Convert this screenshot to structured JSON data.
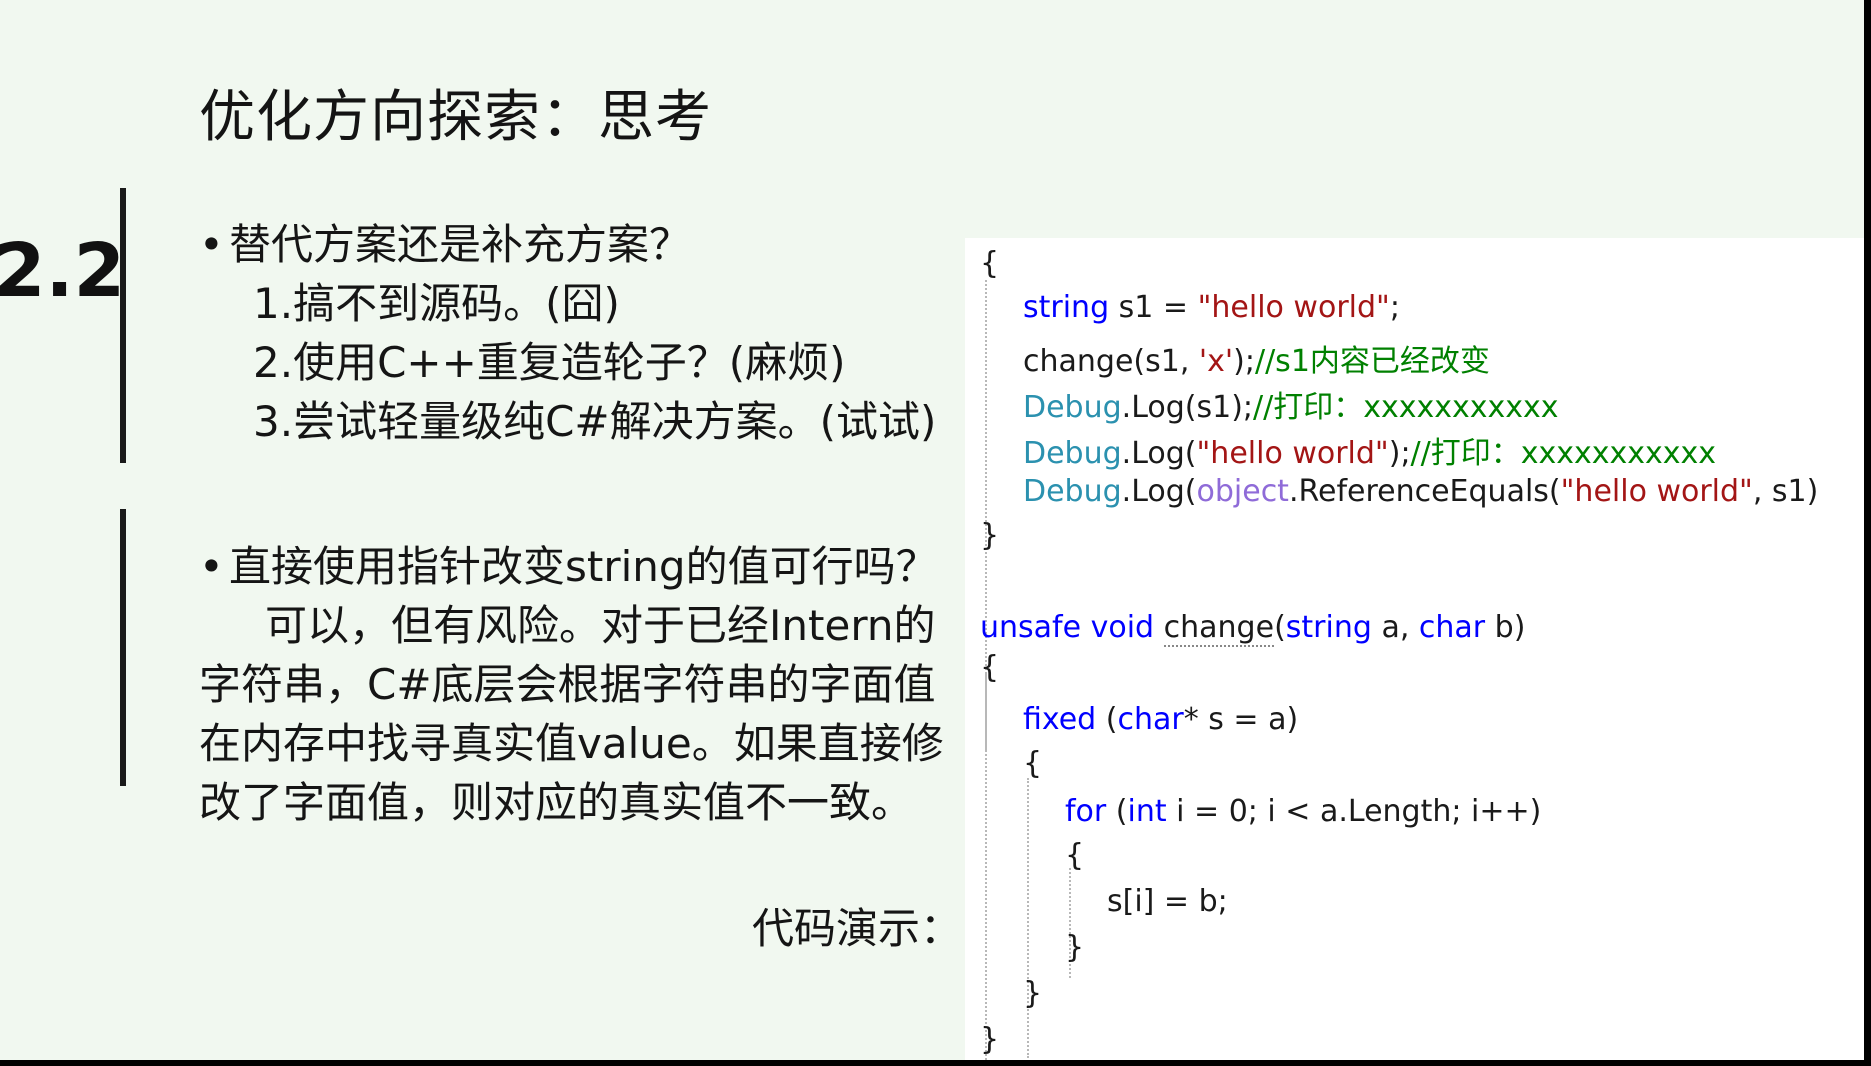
{
  "slide": {
    "title": "优化方向探索：思考",
    "section_number": "2.2",
    "bullet1": {
      "dot": "•",
      "heading": "替代方案还是补充方案？",
      "items": [
        "1.搞不到源码。(囧)",
        "2.使用C++重复造轮子？(麻烦)",
        "3.尝试轻量级纯C#解决方案。(试试)"
      ]
    },
    "bullet2": {
      "dot": "•",
      "heading": "直接使用指针改变string的值可行吗？",
      "lines": [
        "可以，但有风险。对于已经Intern的",
        "字符串，C#底层会根据字符串的字面值",
        "在内存中找寻真实值value。如果直接修",
        "改了字面值，则对应的真实值不一致。"
      ]
    },
    "demo_label": "代码演示："
  },
  "code": {
    "open_brace_1": "{",
    "l1": {
      "kw": "string",
      "rest": " s1 = ",
      "str": "\"hello world\"",
      "end": ";"
    },
    "l2": {
      "plain": "change(s1, ",
      "str": "'x'",
      "mid": ");",
      "comment": "//s1内容已经改变"
    },
    "l3": {
      "type": "Debug",
      "plain": ".Log(s1);",
      "comment": "//打印：xxxxxxxxxxx"
    },
    "l4": {
      "type": "Debug",
      "plain": ".Log(",
      "str": "\"hello world\"",
      "mid": ");",
      "comment": "//打印：xxxxxxxxxxx"
    },
    "l5": {
      "type": "Debug",
      "plain": ".Log(",
      "obj": "object",
      "plain2": ".ReferenceEquals(",
      "str": "\"hello world\"",
      "end": ", s1)"
    },
    "close_brace_1": "}",
    "sig": {
      "kw1": "unsafe",
      "kw2": "void",
      "name": "change",
      "p1": "(",
      "kw3": "string",
      "p2": " a, ",
      "kw4": "char",
      "p3": " b)"
    },
    "open_brace_2": "{",
    "fixed": {
      "kw": "fixed",
      "p1": " (",
      "kw2": "char",
      "p2": "* s = a)"
    },
    "open_brace_3": "{",
    "for": {
      "kw": "for",
      "p1": " (",
      "kw2": "int",
      "p2": " i = 0; i < a.Length; i++)"
    },
    "open_brace_4": "{",
    "assign": "s[i] = b;",
    "close_brace_4": "}",
    "close_brace_3": "}",
    "close_brace_2": "}"
  }
}
